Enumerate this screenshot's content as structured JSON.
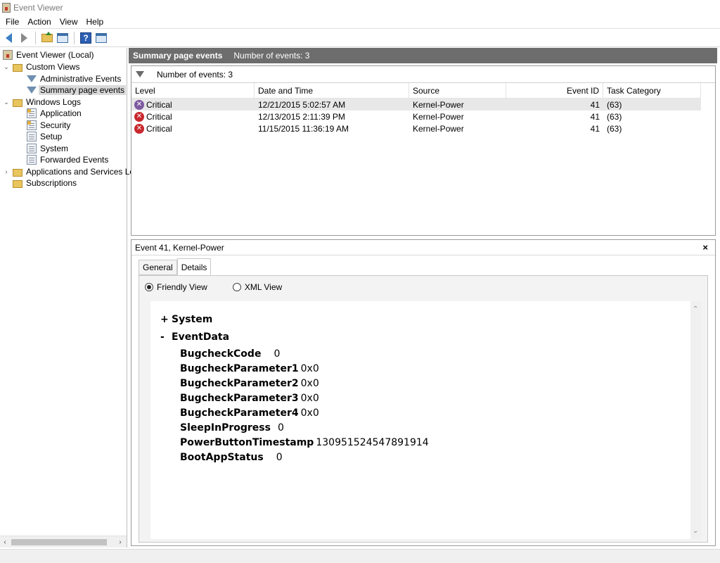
{
  "window": {
    "title": "Event Viewer"
  },
  "menu": [
    "File",
    "Action",
    "View",
    "Help"
  ],
  "toolbar": {
    "icons": [
      "back-arrow-icon",
      "forward-arrow-icon",
      "folder-up-icon",
      "show-hide-pane-icon",
      "help-icon",
      "action-pane-icon"
    ]
  },
  "tree": {
    "root": "Event Viewer (Local)",
    "custom_views": "Custom Views",
    "administrative_events": "Administrative Events",
    "summary_page_events": "Summary page events",
    "windows_logs": "Windows Logs",
    "application": "Application",
    "security": "Security",
    "setup": "Setup",
    "system": "System",
    "forwarded_events": "Forwarded Events",
    "apps_services": "Applications and Services Lo",
    "subscriptions": "Subscriptions"
  },
  "summary": {
    "title": "Summary page events",
    "count_text": "Number of events: 3"
  },
  "events": {
    "filter_text": "Number of events: 3",
    "columns": {
      "level": "Level",
      "date": "Date and Time",
      "source": "Source",
      "id": "Event ID",
      "category": "Task Category"
    },
    "rows": [
      {
        "level": "Critical",
        "date": "12/21/2015 5:02:57 AM",
        "source": "Kernel-Power",
        "id": "41",
        "category": "(63)"
      },
      {
        "level": "Critical",
        "date": "12/13/2015 2:11:39 PM",
        "source": "Kernel-Power",
        "id": "41",
        "category": "(63)"
      },
      {
        "level": "Critical",
        "date": "11/15/2015 11:36:19 AM",
        "source": "Kernel-Power",
        "id": "41",
        "category": "(63)"
      }
    ]
  },
  "detail": {
    "title": "Event 41, Kernel-Power",
    "close": "×",
    "tabs": {
      "general": "General",
      "details": "Details"
    },
    "view_friendly": "Friendly View",
    "view_xml": "XML View",
    "system_toggle": "+",
    "system_label": "System",
    "eventdata_toggle": "-",
    "eventdata_label": "EventData",
    "fields": [
      {
        "key": "BugcheckCode",
        "value": "0"
      },
      {
        "key": "BugcheckParameter1",
        "value": "0x0"
      },
      {
        "key": "BugcheckParameter2",
        "value": "0x0"
      },
      {
        "key": "BugcheckParameter3",
        "value": "0x0"
      },
      {
        "key": "BugcheckParameter4",
        "value": "0x0"
      },
      {
        "key": "SleepInProgress",
        "value": "0"
      },
      {
        "key": "PowerButtonTimestamp",
        "value": "130951524547891914"
      },
      {
        "key": "BootAppStatus",
        "value": "0"
      }
    ]
  }
}
